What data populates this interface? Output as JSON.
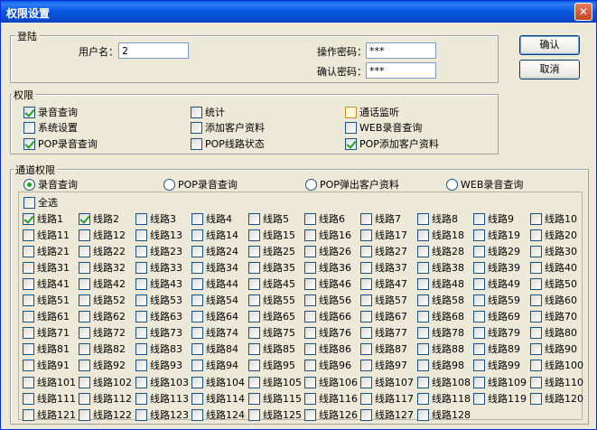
{
  "window": {
    "title": "权限设置",
    "close_glyph": "✕"
  },
  "login": {
    "legend": "登陆",
    "username_label": "用户名：",
    "username_value": "2",
    "op_password_label": "操作密码：",
    "op_password_value": "***",
    "confirm_password_label": "确认密码：",
    "confirm_password_value": "***"
  },
  "buttons": {
    "ok": "确认",
    "cancel": "取消"
  },
  "permissions": {
    "legend": "权限",
    "items": [
      {
        "label": "录音查询",
        "checked": true
      },
      {
        "label": "统计",
        "checked": false
      },
      {
        "label": "通话监听",
        "checked": false
      },
      {
        "label": "系统设置",
        "checked": false
      },
      {
        "label": "添加客户资料",
        "checked": false
      },
      {
        "label": "WEB录音查询",
        "checked": false
      },
      {
        "label": "POP录音查询",
        "checked": true
      },
      {
        "label": "POP线路状态",
        "checked": false
      },
      {
        "label": "POP添加客户资料",
        "checked": true
      }
    ]
  },
  "channels": {
    "legend": "通道权限",
    "radios": [
      {
        "label": "录音查询",
        "selected": true
      },
      {
        "label": "POP录音查询",
        "selected": false
      },
      {
        "label": "POP弹出客户资料",
        "selected": false
      },
      {
        "label": "WEB录音查询",
        "selected": false
      }
    ],
    "select_all": "全选",
    "line_prefix": "线路",
    "line_count": 128,
    "checked_lines": [
      1,
      2
    ]
  }
}
